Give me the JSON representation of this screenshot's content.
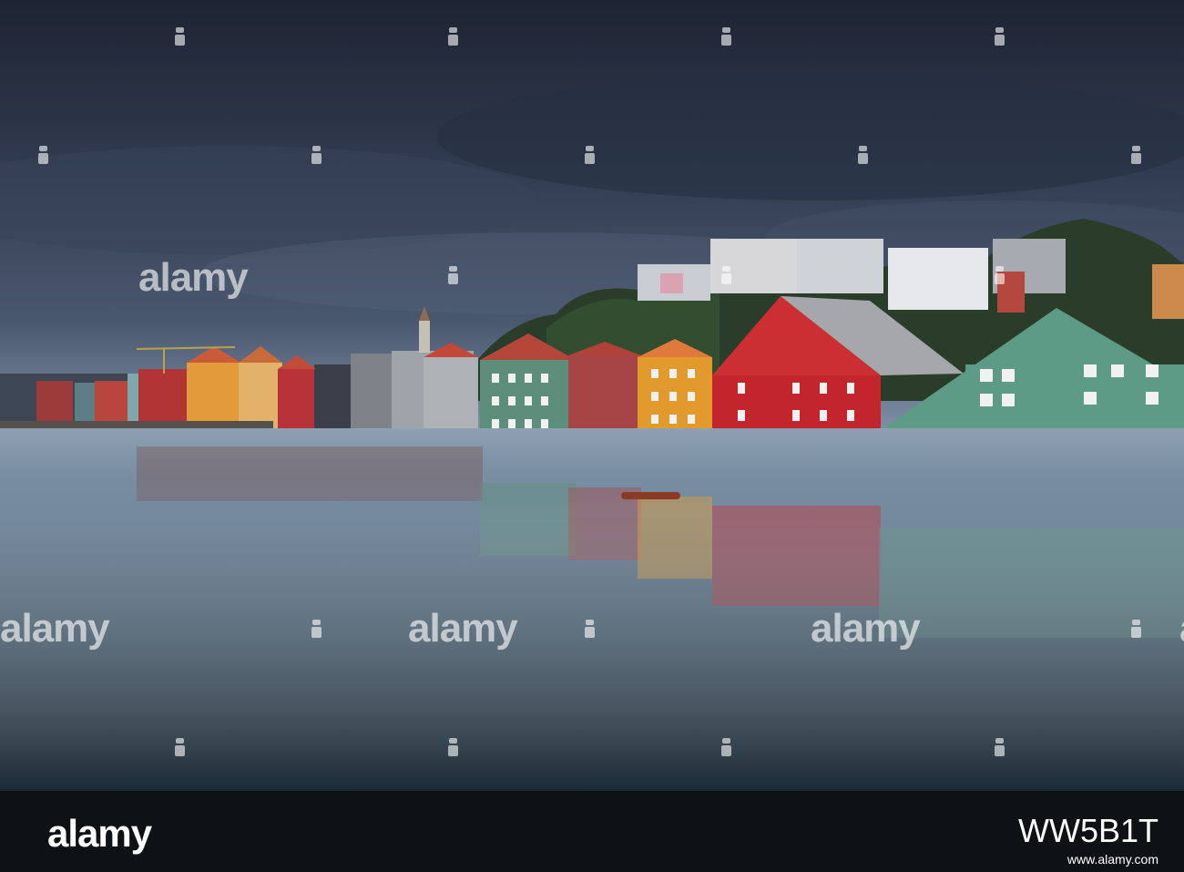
{
  "watermark": {
    "text": "alamy",
    "icon": "alamy-a-icon"
  },
  "footer": {
    "logo_text": "alamy",
    "image_id": "WW5B1T",
    "url": "www.alamy.com"
  },
  "colors": {
    "sky_top": "#252c3d",
    "sky_bottom": "#5b6b83",
    "water": "#3d5469",
    "footer_bg": "#0f1215",
    "house_red": "#b3262b",
    "house_green": "#4e8c78",
    "house_yellow": "#e1962c"
  }
}
